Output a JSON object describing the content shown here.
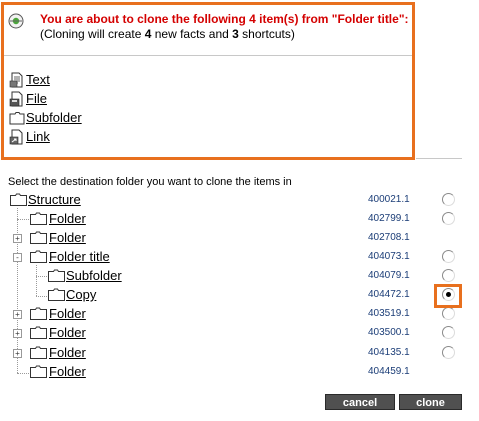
{
  "dialog": {
    "title": "You are about to clone the following 4 item(s) from \"Folder title\":",
    "sub_prefix": "(Cloning will create ",
    "sub_facts": "4",
    "sub_mid": " new facts and ",
    "sub_shortcuts": "3",
    "sub_suffix": " shortcuts)",
    "items": [
      {
        "label": "Text",
        "icon": "text-document-icon"
      },
      {
        "label": "File",
        "icon": "file-document-icon"
      },
      {
        "label": "Subfolder",
        "icon": "folder-icon"
      },
      {
        "label": "Link",
        "icon": "link-document-icon"
      }
    ]
  },
  "instruction": "Select the destination folder you want to clone the items in",
  "tree": [
    {
      "label": "Structure",
      "id": "400021.1",
      "depth": 0,
      "expander": "",
      "radio": "unchecked"
    },
    {
      "label": "Folder",
      "id": "402799.1",
      "depth": 1,
      "expander": "",
      "radio": "unchecked"
    },
    {
      "label": "Folder",
      "id": "402708.1",
      "depth": 1,
      "expander": "+",
      "radio": "none"
    },
    {
      "label": "Folder title",
      "id": "404073.1",
      "depth": 1,
      "expander": "-",
      "radio": "unchecked"
    },
    {
      "label": "Subfolder",
      "id": "404079.1",
      "depth": 2,
      "expander": "",
      "radio": "unchecked"
    },
    {
      "label": "Copy",
      "id": "404472.1",
      "depth": 2,
      "expander": "",
      "radio": "checked"
    },
    {
      "label": "Folder",
      "id": "403519.1",
      "depth": 1,
      "expander": "+",
      "radio": "unchecked"
    },
    {
      "label": "Folder",
      "id": "403500.1",
      "depth": 1,
      "expander": "+",
      "radio": "unchecked"
    },
    {
      "label": "Folder",
      "id": "404135.1",
      "depth": 1,
      "expander": "+",
      "radio": "unchecked"
    },
    {
      "label": "Folder",
      "id": "404459.1",
      "depth": 1,
      "expander": "",
      "radio": "none"
    }
  ],
  "buttons": {
    "cancel": "cancel",
    "clone": "clone"
  },
  "colors": {
    "accent": "#e8701e",
    "title_red": "#d40000",
    "id_blue": "#1b3d77",
    "button_bg": "#505050"
  }
}
